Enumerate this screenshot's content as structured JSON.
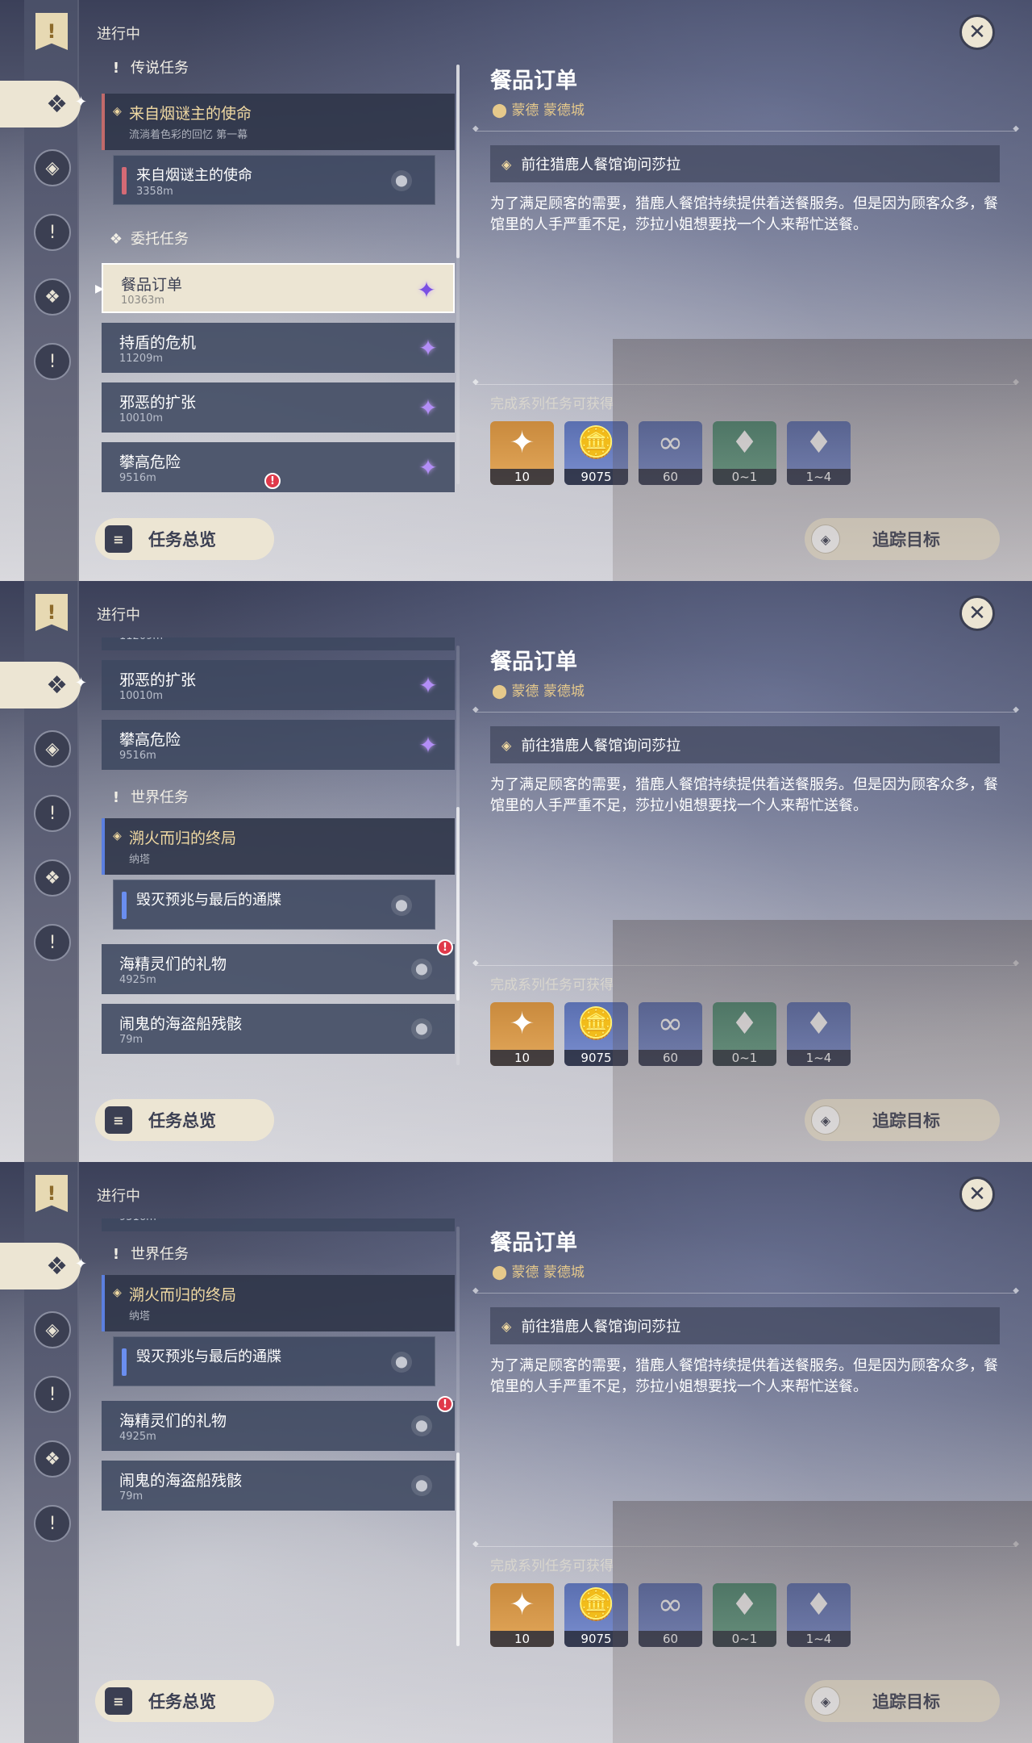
{
  "ui": {
    "in_progress": "进行中",
    "close_icon": "✕",
    "overview_button": "任务总览",
    "track_button": "追踪目标"
  },
  "categories": {
    "legend": "传说任务",
    "commission": "委托任务",
    "world": "世界任务"
  },
  "quests": {
    "archon": {
      "title": "来自烟谜主的使命",
      "subtitle": "流淌着色彩的回忆 第一幕"
    },
    "archon_sub": {
      "title": "来自烟谜主的使命",
      "distance": "3358m"
    },
    "c1": {
      "title": "餐品订单",
      "distance": "10363m"
    },
    "c2": {
      "title": "持盾的危机",
      "distance": "11209m"
    },
    "c3": {
      "title": "邪恶的扩张",
      "distance": "10010m"
    },
    "c4": {
      "title": "攀高危险",
      "distance": "9516m"
    },
    "w_arch": {
      "title": "溯火而归的终局",
      "subtitle": "纳塔"
    },
    "w_sub": {
      "title": "毁灭预兆与最后的通牒"
    },
    "w1": {
      "title": "海精灵们的礼物",
      "distance": "4925m"
    },
    "w2": {
      "title": "闹鬼的海盗船残骸",
      "distance": "79m"
    }
  },
  "detail": {
    "title": "餐品订单",
    "location": "蒙德 蒙德城",
    "objective": "前往猎鹿人餐馆询问莎拉",
    "description": "为了满足顾客的需要，猎鹿人餐馆持续提供着送餐服务。但是因为顾客众多，餐馆里的人手严重不足，莎拉小姐想要找一个人来帮忙送餐。",
    "rewards_label": "完成系列任务可获得",
    "rewards": [
      {
        "icon": "primogem-icon",
        "qty": "10"
      },
      {
        "icon": "mora-icon",
        "qty": "9075"
      },
      {
        "icon": "companionship-exp-icon",
        "qty": "60"
      },
      {
        "icon": "crystal-chunk-icon",
        "qty": "0~1"
      },
      {
        "icon": "magical-crystal-icon",
        "qty": "1~4"
      }
    ]
  },
  "colors": {
    "accent": "#ece5d3",
    "dark": "#3b3f52",
    "gold": "#f0d9a2",
    "alert": "#e0394a"
  }
}
